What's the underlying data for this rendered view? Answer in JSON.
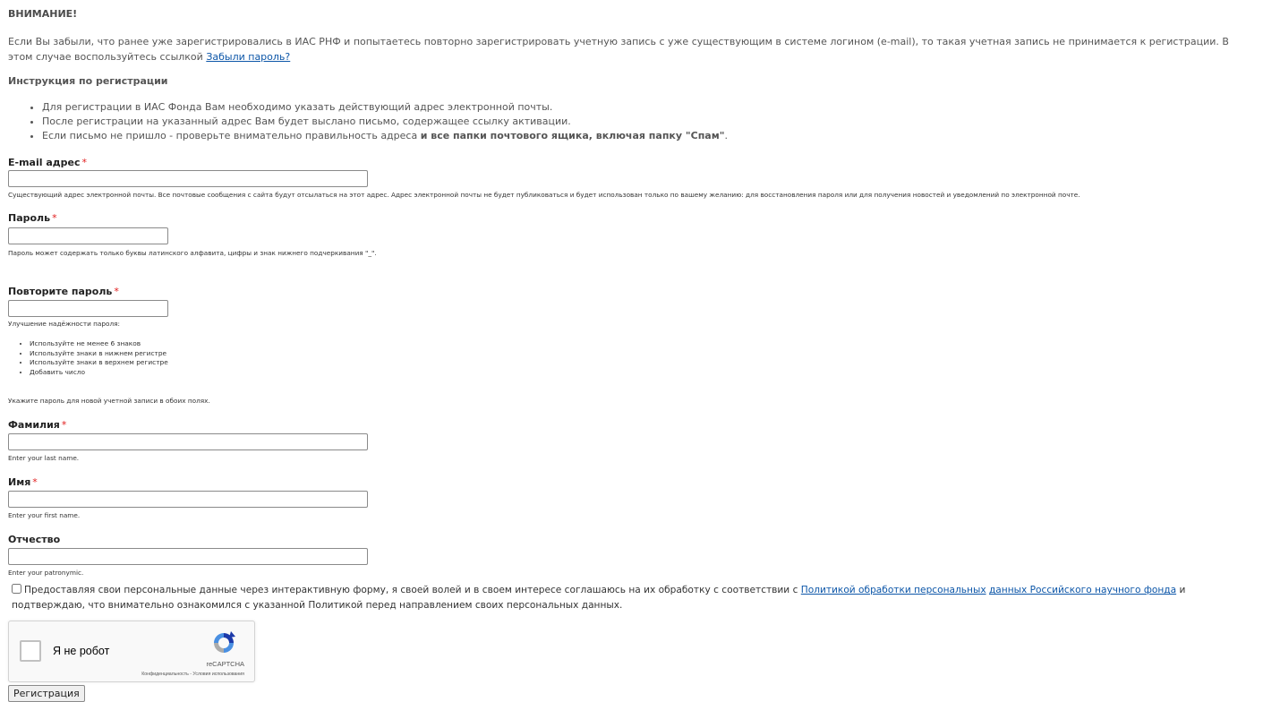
{
  "notice": {
    "title": "ВНИМАНИЕ!",
    "text": "Если Вы забыли, что ранее уже зарегистрировались в ИАС РНФ и попытаетесь повторно зарегистрировать учетную запись с уже существующим в системе логином (e-mail), то такая учетная запись не принимается к регистрации. В этом случае воспользуйтесь ссылкой ",
    "link": "Забыли пароль?"
  },
  "instructions": {
    "title": "Инструкция по регистрации",
    "items": [
      "Для регистрации в ИАС Фонда Вам необходимо указать действующий адрес электронной почты.",
      "После регистрации на указанный адрес Вам будет выслано письмо, содержащее ссылку активации."
    ],
    "item3_text": "Если письмо не пришло - проверьте внимательно правильность адреса ",
    "item3_bold": "и все папки почтового ящика, включая папку \"Спам\"",
    "item3_end": "."
  },
  "form": {
    "required_mark": "*",
    "email": {
      "label": "E-mail адрес",
      "value": "",
      "description": "Существующий адрес электронной почты. Все почтовые сообщения с сайта будут отсылаться на этот адрес. Адрес электронной почты не будет публиковаться и будет использован только по вашему желанию: для восстановления пароля или для получения новостей и уведомлений по электронной почте."
    },
    "password": {
      "label": "Пароль",
      "value": "",
      "description": "Пароль может содержать только буквы латинского алфавита, цифры и знак нижнего подчеркивания \"_\"."
    },
    "password_confirm": {
      "label": "Повторите пароль",
      "value": "",
      "strength_title": "Улучшение надёжности пароля:",
      "tips": [
        "Используйте не менее 6 знаков",
        "Используйте знаки в нижнем регистре",
        "Используйте знаки в верхнем регистре",
        "Добавить число"
      ],
      "note": "Укажите пароль для новой учетной записи в обоих полях."
    },
    "last_name": {
      "label": "Фамилия",
      "value": "",
      "description": "Enter your last name."
    },
    "first_name": {
      "label": "Имя",
      "value": "",
      "description": "Enter your first name."
    },
    "patronymic": {
      "label": "Отчество",
      "value": "",
      "description": "Enter your patronymic."
    },
    "consent": {
      "checked": false,
      "text_before": "Предоставляя свои персональные данные через интерактивную форму, я своей волей и в своем интересе соглашаюсь на их обработку с соответствии с ",
      "link1": "Политикой обработки персональных",
      "link2": "данных Российского научного фонда",
      "text_after": " и подтверждаю, что внимательно ознакомился с указанной Политикой перед направлением своих персональных данных."
    },
    "recaptcha": {
      "label": "Я не робот",
      "brand": "reCAPTCHA",
      "links": "Конфиденциальность - Условия использования"
    },
    "submit_label": "Регистрация"
  },
  "colors": {
    "link": "#0c56a8",
    "required": "#e11d1d"
  }
}
